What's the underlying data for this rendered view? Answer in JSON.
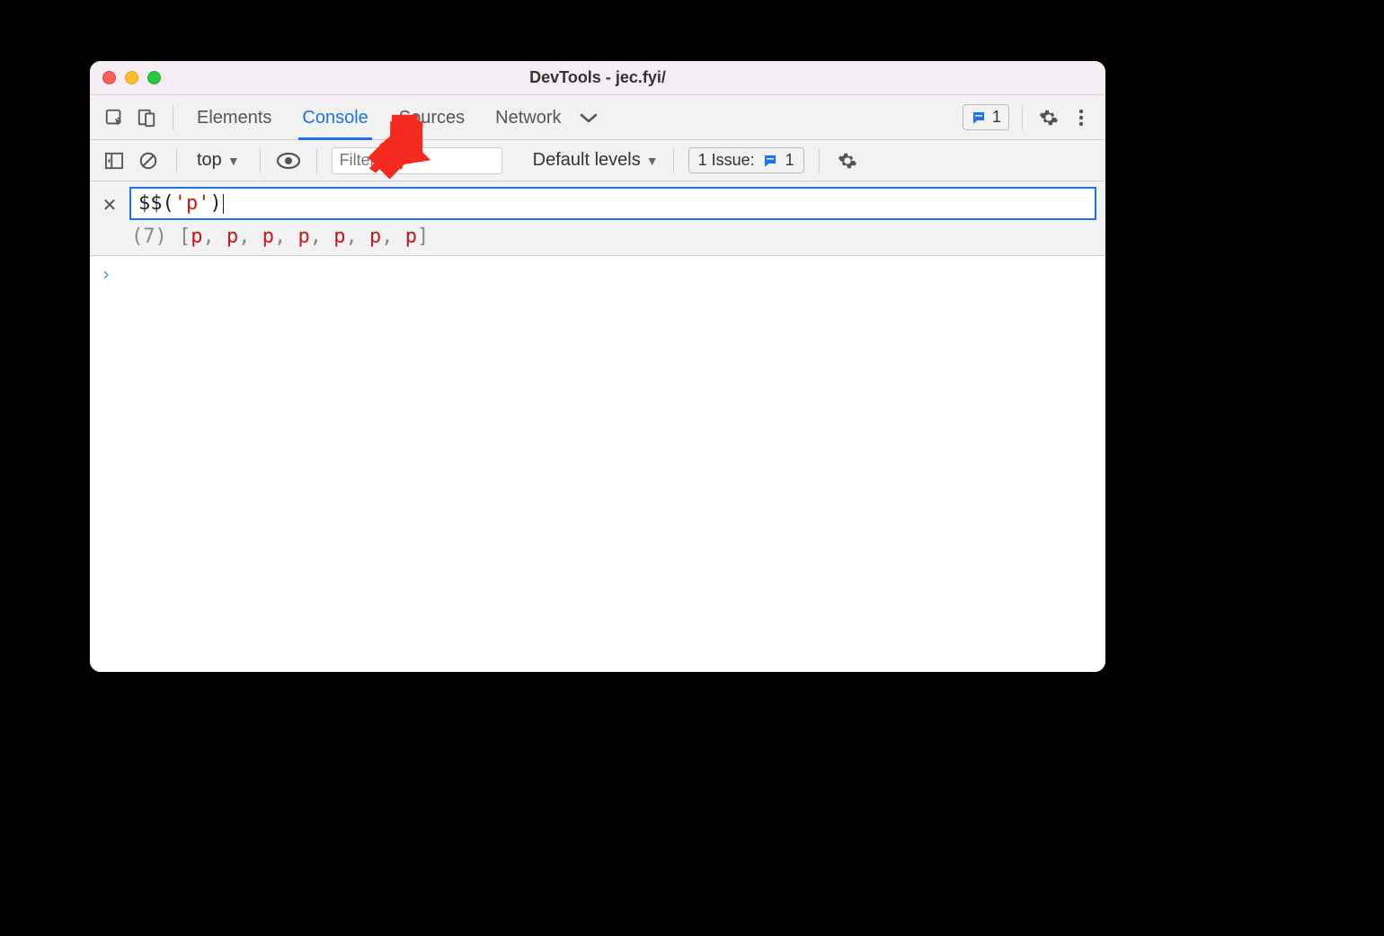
{
  "window": {
    "title": "DevTools - jec.fyi/"
  },
  "tabs": {
    "items": [
      "Elements",
      "Console",
      "Sources",
      "Network"
    ],
    "activeIndex": 1
  },
  "topbar": {
    "feedback_count": "1"
  },
  "consoleBar": {
    "context": "top",
    "filter_placeholder": "Filter",
    "levels_label": "Default levels",
    "issues_label": "1 Issue:",
    "issues_count": "1"
  },
  "eval": {
    "expression": {
      "fn": "$$",
      "open": "(",
      "str_quote": "'",
      "str_val": "p",
      "close": ")"
    },
    "result": {
      "count": "(7)",
      "elems": [
        "p",
        "p",
        "p",
        "p",
        "p",
        "p",
        "p"
      ]
    }
  },
  "annotation": {
    "color": "#f5291f"
  }
}
